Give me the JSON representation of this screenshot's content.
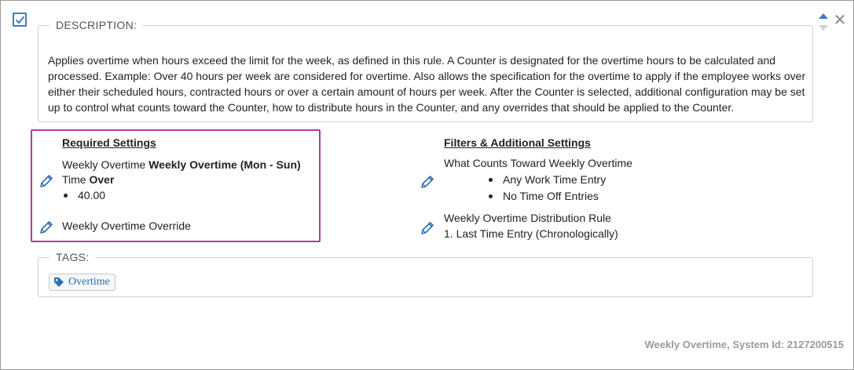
{
  "card": {
    "selected": true,
    "description_label": "DESCRIPTION:",
    "description_text": "Applies overtime when hours exceed the limit for the week, as defined in this rule. A Counter is designated for the overtime hours to be calculated and processed. Example: Over 40 hours per week are considered for overtime. Also allows the specification for the overtime to apply if the employee works over either their scheduled hours, contracted hours or over a certain amount of hours per week. After the Counter is selected, additional configuration may be set up to control what counts toward the Counter, how to distribute hours in the Counter, and any overrides that should be applied to the Counter.",
    "close_glyph": "✕"
  },
  "required": {
    "title": "Required Settings",
    "line1_prefix": "Weekly Overtime ",
    "line1_bold": "Weekly Overtime  (Mon - Sun)",
    "line2_prefix": "Time ",
    "line2_bold": "Over",
    "value": "40.00",
    "override": "Weekly Overtime Override"
  },
  "filters": {
    "title": "Filters & Additional Settings",
    "counts_label": "What Counts Toward Weekly Overtime",
    "counts_items": [
      "Any Work Time Entry",
      "No Time Off Entries"
    ],
    "distribution_label": "Weekly Overtime Distribution Rule",
    "distribution_item": "1.  Last Time Entry (Chronologically)"
  },
  "tags": {
    "label": "TAGS:",
    "items": [
      "Overtime"
    ]
  },
  "footer": {
    "text": "Weekly Overtime, System Id: 2127200515"
  },
  "colors": {
    "accent": "#2f6fae",
    "highlight": "#b23aa8",
    "checkbox": "#3b7dc4"
  },
  "icons": {
    "edit": "pencil-icon",
    "tag": "tag-icon",
    "close": "close-icon",
    "sort": "sort-arrows-icon",
    "check": "checkbox-icon"
  }
}
